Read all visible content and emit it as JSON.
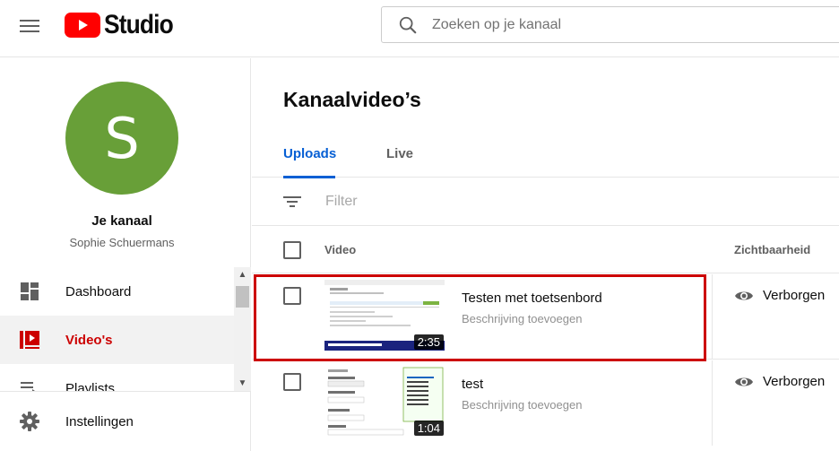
{
  "header": {
    "logo_text": "Studio",
    "search_placeholder": "Zoeken op je kanaal",
    "brand_color": "#ff0000"
  },
  "sidebar": {
    "avatar_letter": "S",
    "avatar_color": "#689f38",
    "channel_title": "Je kanaal",
    "channel_name": "Sophie Schuermans",
    "items": [
      {
        "label": "Dashboard",
        "icon": "dashboard-icon",
        "active": false
      },
      {
        "label": "Video's",
        "icon": "video-icon",
        "active": true
      },
      {
        "label": "Playlists",
        "icon": "playlist-icon",
        "active": false
      }
    ],
    "settings_label": "Instellingen"
  },
  "main": {
    "title": "Kanaalvideo’s",
    "tabs": [
      {
        "label": "Uploads",
        "active": true
      },
      {
        "label": "Live",
        "active": false
      }
    ],
    "filter_placeholder": "Filter",
    "columns": {
      "video": "Video",
      "visibility": "Zichtbaarheid"
    },
    "videos": [
      {
        "title": "Testen met toetsenbord",
        "description": "Beschrijving toevoegen",
        "duration": "2:35",
        "visibility": "Verborgen"
      },
      {
        "title": "test",
        "description": "Beschrijving toevoegen",
        "duration": "1:04",
        "visibility": "Verborgen"
      }
    ]
  }
}
